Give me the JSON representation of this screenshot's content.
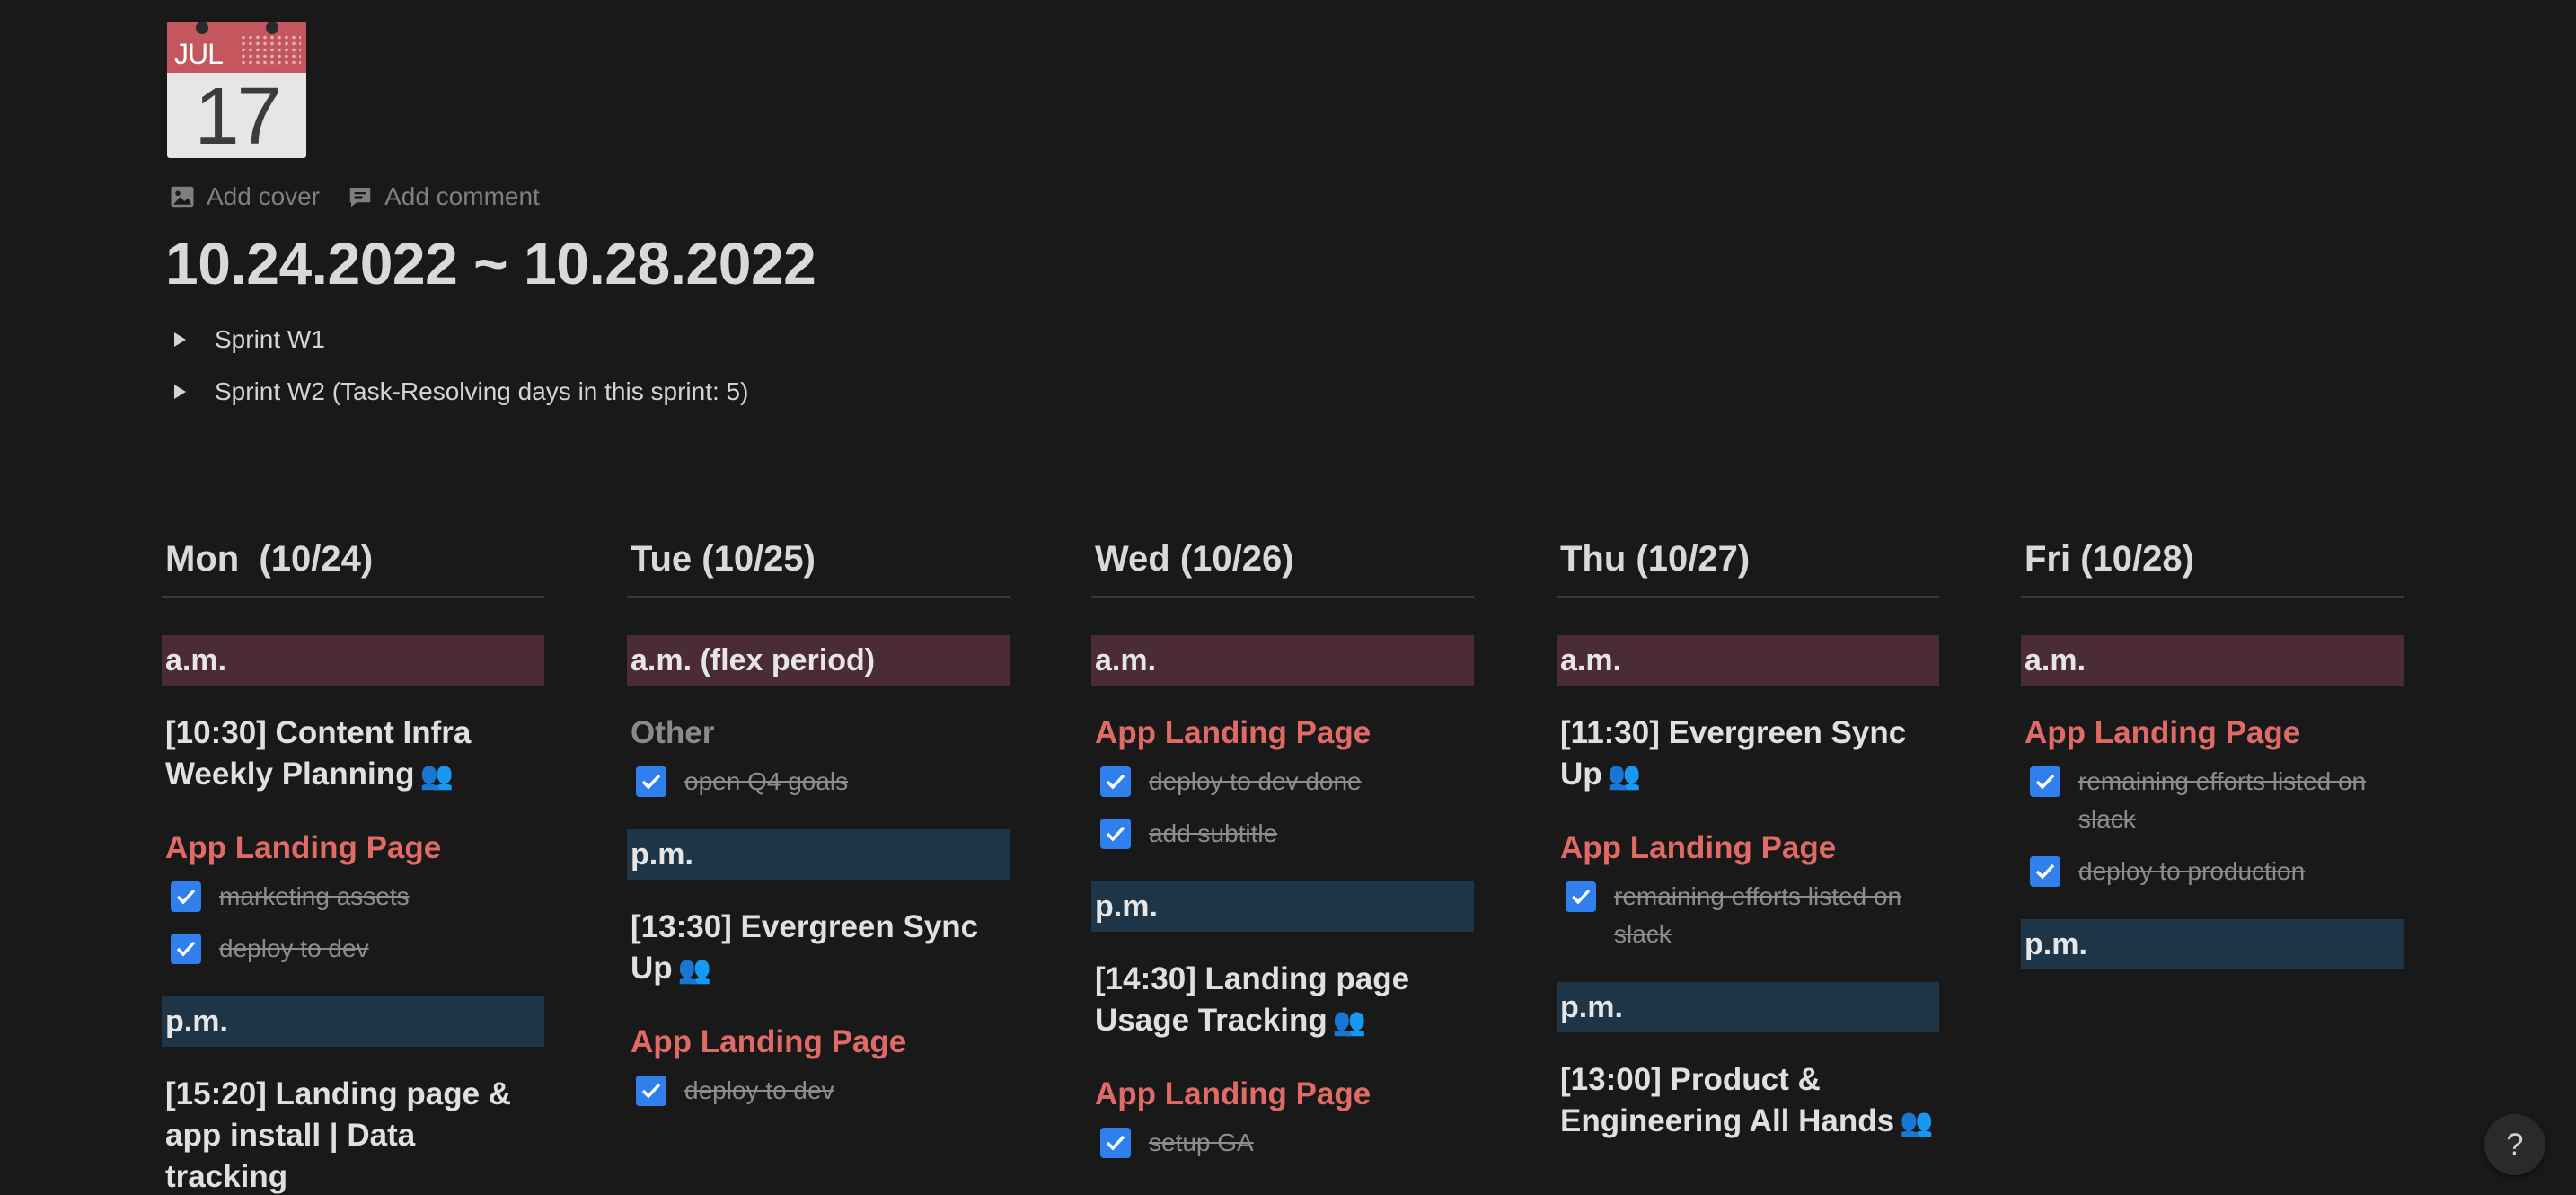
{
  "page": {
    "icon": {
      "month": "JUL",
      "day": "17"
    },
    "add_cover": "Add cover",
    "add_comment": "Add comment",
    "title": "10.24.2022 ~ 10.28.2022",
    "toggles": [
      "Sprint W1",
      "Sprint W2 (Task-Resolving days in this sprint: 5)"
    ]
  },
  "days": [
    {
      "header": "Mon  (10/24)",
      "am_label": "a.m.",
      "am_event": "[10:30] Content Infra Weekly Planning",
      "am_group": {
        "title": "App Landing Page",
        "todos": [
          "marketing assets",
          "deploy to dev"
        ]
      },
      "pm_label": "p.m.",
      "pm_event": "[15:20] Landing page & app install | Data tracking"
    },
    {
      "header": "Tue (10/25)",
      "am_label": "a.m. (flex period)",
      "am_group": {
        "title": "Other",
        "todos": [
          "open Q4 goals"
        ]
      },
      "pm_label": "p.m.",
      "pm_event": "[13:30] Evergreen Sync Up",
      "pm_group": {
        "title": "App Landing Page",
        "todos": [
          "deploy to dev"
        ]
      }
    },
    {
      "header": "Wed (10/26)",
      "am_label": "a.m.",
      "am_group": {
        "title": "App Landing Page",
        "todos": [
          "deploy to dev done",
          "add subtitle"
        ]
      },
      "pm_label": "p.m.",
      "pm_event": "[14:30] Landing page Usage Tracking",
      "pm_group": {
        "title": "App Landing Page",
        "todos": [
          "setup GA"
        ]
      }
    },
    {
      "header": "Thu (10/27)",
      "am_label": "a.m.",
      "am_event": "[11:30] Evergreen Sync Up",
      "am_group": {
        "title": "App Landing Page",
        "todos": [
          "remaining efforts listed on slack"
        ]
      },
      "pm_label": "p.m.",
      "pm_event": "[13:00] Product & Engineering All Hands"
    },
    {
      "header": "Fri (10/28)",
      "am_label": "a.m.",
      "am_group": {
        "title": "App Landing Page",
        "todos": [
          "remaining efforts listed on slack",
          "deploy to production"
        ]
      },
      "pm_label": "p.m."
    }
  ],
  "people_icon": "people-icon",
  "help_label": "?",
  "colors": {
    "background": "#191919",
    "am_band": "#4b2b35",
    "pm_band": "#1e3447",
    "group_red": "#e06b66",
    "checkbox": "#2f80ed"
  }
}
